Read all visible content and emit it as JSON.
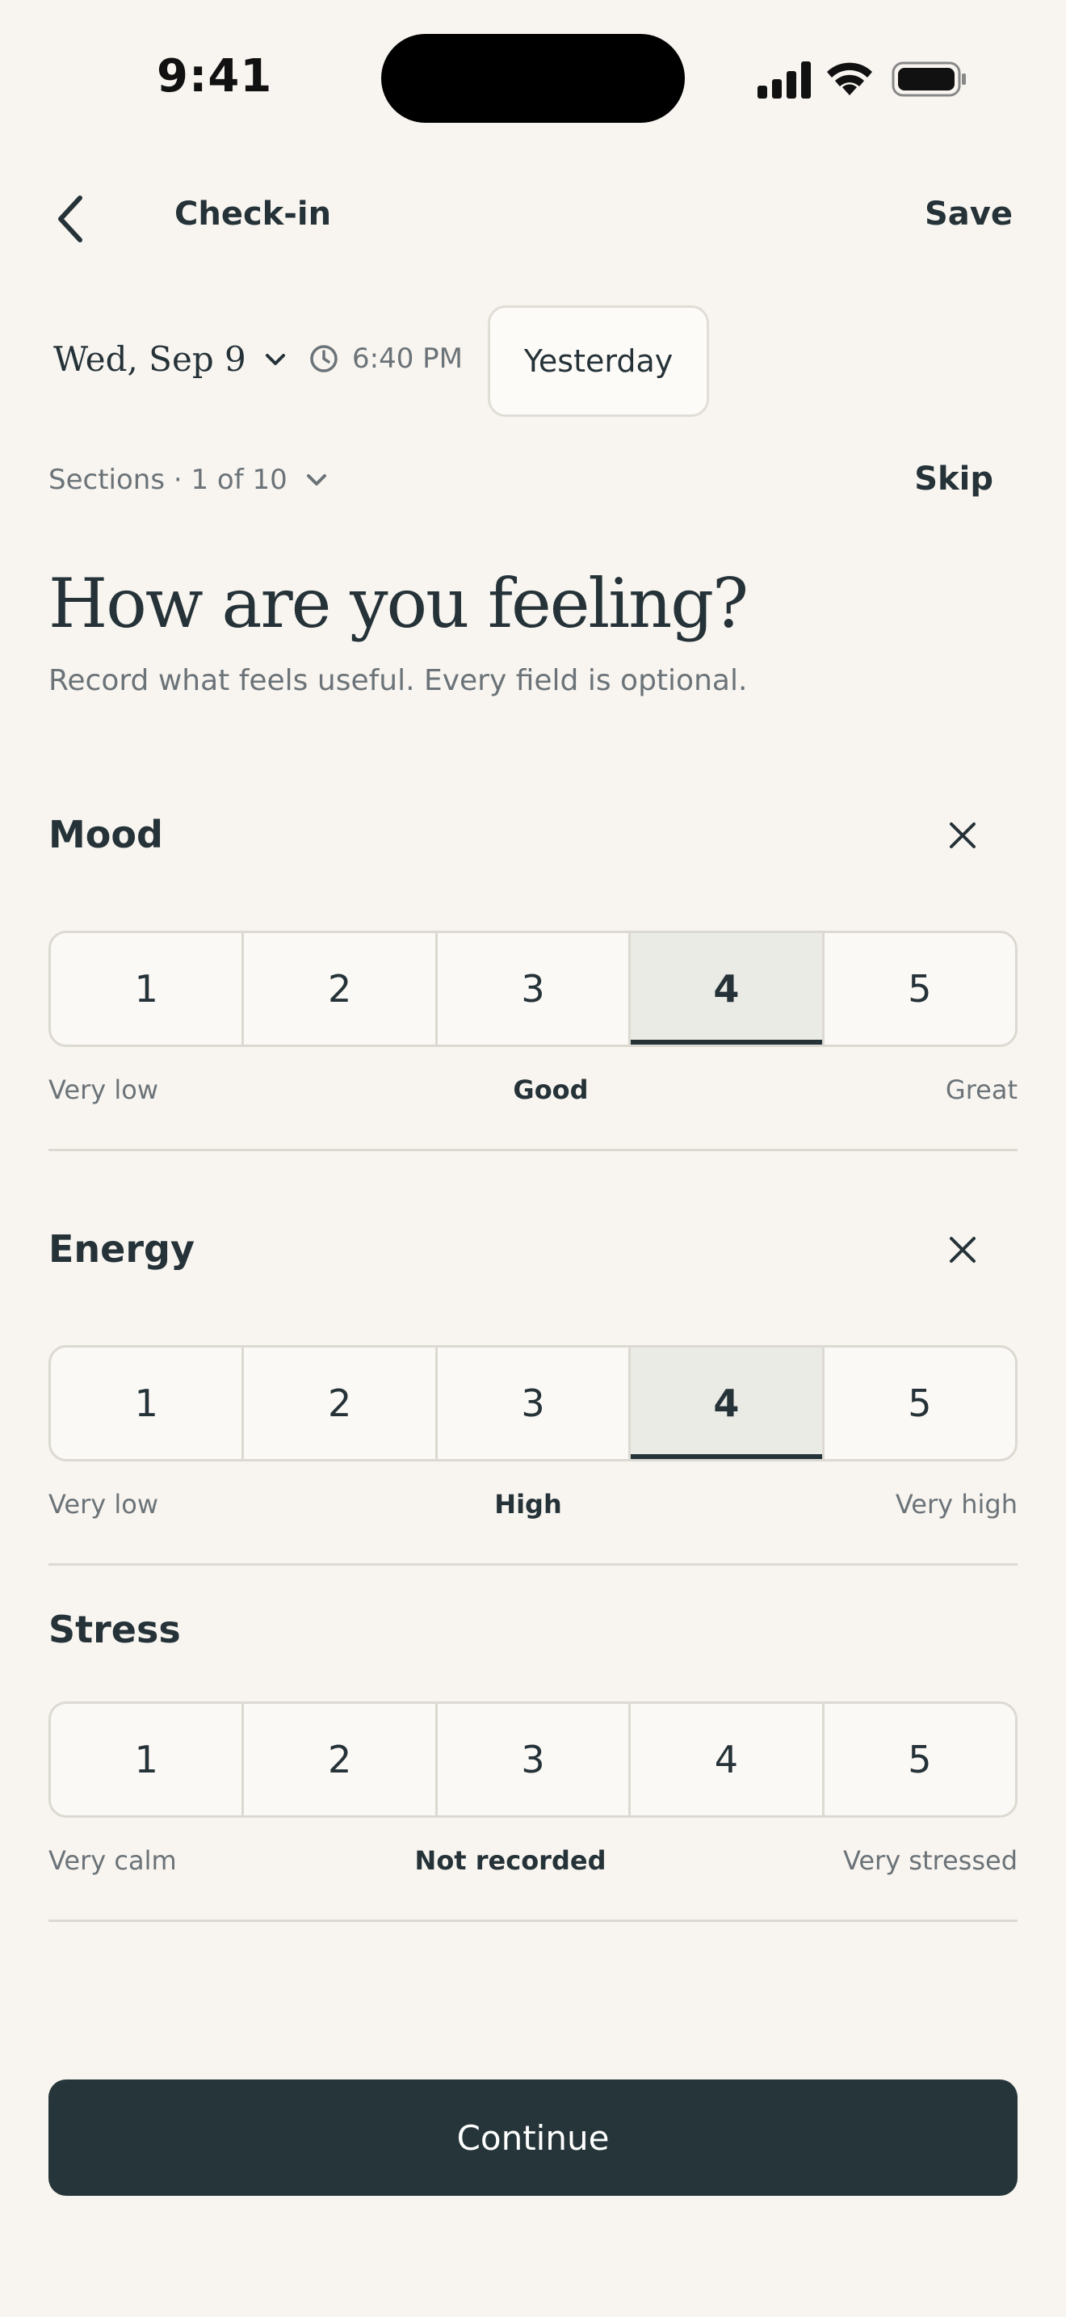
{
  "status": {
    "time": "9:41"
  },
  "header": {
    "title": "Check-in",
    "save_label": "Save"
  },
  "date_row": {
    "date": "Wed, Sep 9",
    "time": "6:40 PM",
    "yesterday_label": "Yesterday"
  },
  "sections": {
    "label": "Sections · 1 of 10",
    "skip_label": "Skip"
  },
  "headline": "How are you feeling?",
  "subline": "Record what feels useful. Every field is optional.",
  "ratings": [
    {
      "title": "Mood",
      "options": [
        "1",
        "2",
        "3",
        "4",
        "5"
      ],
      "selected": 4,
      "min_label": "Very low",
      "current_label": "Good",
      "max_label": "Great",
      "clearable": true
    },
    {
      "title": "Energy",
      "options": [
        "1",
        "2",
        "3",
        "4",
        "5"
      ],
      "selected": 4,
      "min_label": "Very low",
      "current_label": "High",
      "max_label": "Very high",
      "clearable": true
    },
    {
      "title": "Stress",
      "options": [
        "1",
        "2",
        "3",
        "4",
        "5"
      ],
      "selected": null,
      "min_label": "Very calm",
      "current_label": "Not recorded",
      "max_label": "Very stressed",
      "clearable": false
    }
  ],
  "continue_label": "Continue",
  "colors": {
    "background": "#f8f5f0",
    "text": "#253238",
    "muted": "#6b7378",
    "border": "#dcd9d2",
    "primary_button": "#253539",
    "selected_segment": "#ebebe6"
  }
}
